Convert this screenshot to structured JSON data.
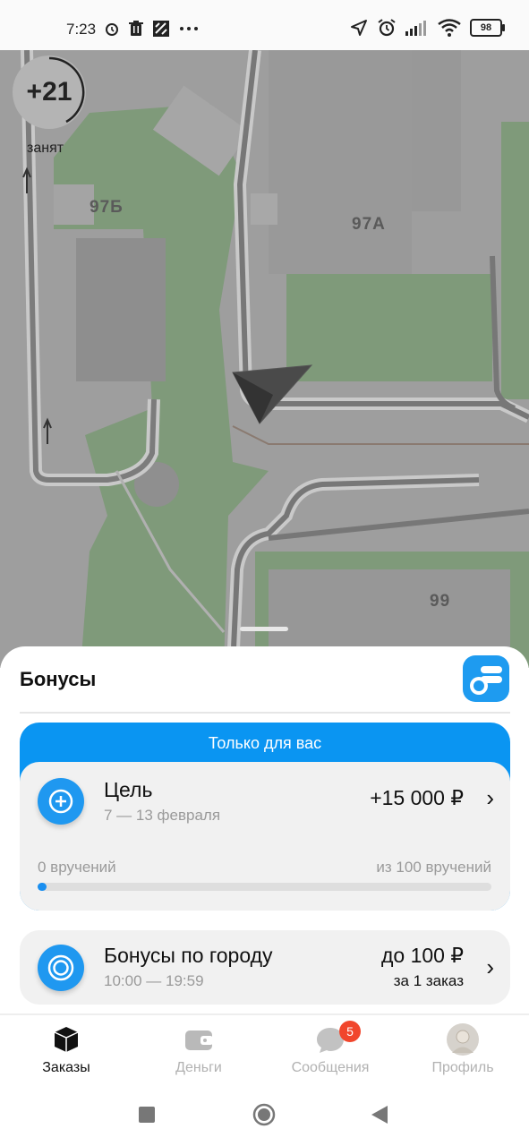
{
  "status_bar": {
    "time": "7:23",
    "battery": "98",
    "left_icons": [
      "alarm-icon",
      "trash-icon",
      "app-notification-icon",
      "more-dots-icon"
    ],
    "right_icons": [
      "location-arrow-icon",
      "alarm-icon",
      "signal-icon",
      "wifi-icon",
      "battery-icon"
    ]
  },
  "map": {
    "earnings_badge": "+21",
    "driver_status": "занят",
    "building_labels": [
      "97Б",
      "97А",
      "99"
    ]
  },
  "sheet": {
    "title": "Бонусы",
    "logo_icon": "coins-stack-icon",
    "exclusive_offer": {
      "header": "Только для вас",
      "goal": {
        "title": "Цель",
        "dates": "7 — 13 февраля",
        "amount": "+15 000 ₽",
        "progress_left": "0 вручений",
        "progress_right": "из 100 вручений",
        "progress_fraction": 0.01
      }
    },
    "city_bonus": {
      "title": "Бонусы по городу",
      "hours": "10:00 — 19:59",
      "amount": "до 100 ₽",
      "subtitle": "за 1 заказ"
    },
    "chevron": "›"
  },
  "tabbar": {
    "tabs": [
      {
        "label": "Заказы",
        "icon": "box-icon",
        "active": true
      },
      {
        "label": "Деньги",
        "icon": "wallet-icon",
        "active": false
      },
      {
        "label": "Сообщения",
        "icon": "chat-icon",
        "active": false,
        "badge": "5"
      },
      {
        "label": "Профиль",
        "icon": "avatar-icon",
        "active": false
      }
    ]
  },
  "colors": {
    "accent": "#0a95f2",
    "badge": "#f1462c",
    "map_overlay": "#9c9c9c"
  }
}
